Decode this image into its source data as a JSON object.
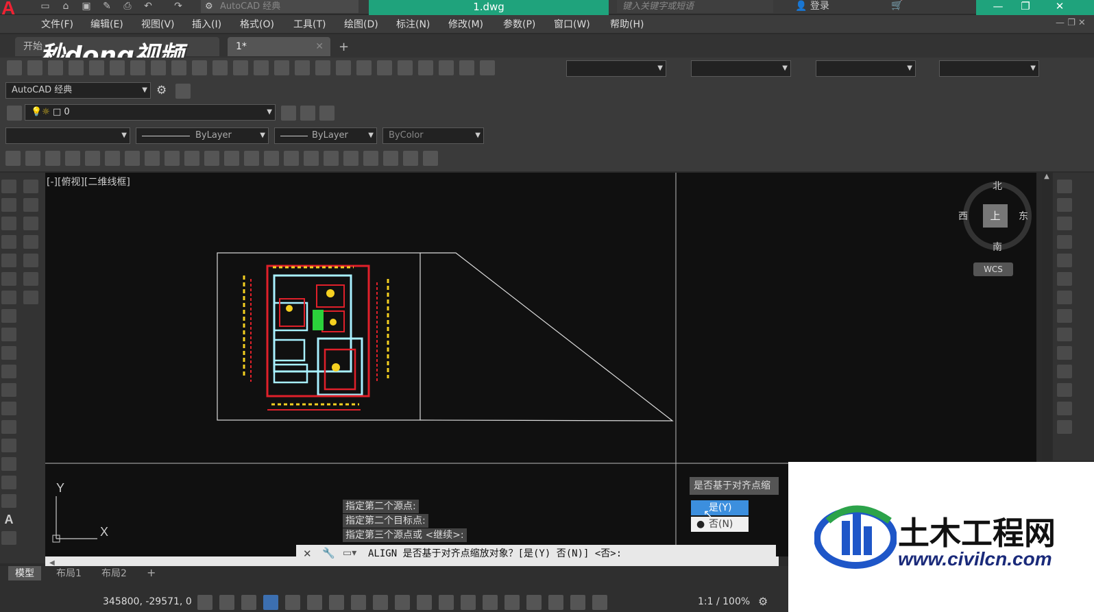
{
  "window": {
    "title": "1.dwg",
    "workspace_combo": "AutoCAD 经典",
    "search_placeholder": "键入关键字或短语",
    "login": "登录"
  },
  "menu": [
    "文件(F)",
    "编辑(E)",
    "视图(V)",
    "插入(I)",
    "格式(O)",
    "工具(T)",
    "绘图(D)",
    "标注(N)",
    "修改(M)",
    "参数(P)",
    "窗口(W)",
    "帮助(H)"
  ],
  "tabs": {
    "start": "开始",
    "doc": "1*",
    "watermark": "秒dong视频"
  },
  "toolbar": {
    "workspace": "AutoCAD 经典",
    "layer": "0",
    "linetype": "ByLayer",
    "lineweight": "ByLayer",
    "plotstyle": "ByColor"
  },
  "canvas": {
    "view_label": "[-][俯视][二维线框]",
    "compass": {
      "north": "北",
      "south": "南",
      "east": "东",
      "west": "西",
      "top": "上"
    },
    "wcs": "WCS",
    "ucs_x": "X",
    "ucs_y": "Y"
  },
  "command": {
    "history": [
      "指定第二个源点:",
      "指定第二个目标点:",
      "指定第三个源点或 <继续>:"
    ],
    "prompt": "ALIGN 是否基于对齐点缩放对象？[是(Y) 否(N)] <否>:"
  },
  "popup": {
    "title": "是否基于对齐点缩",
    "yes": "是(Y)",
    "no": "否(N)"
  },
  "layout_tabs": [
    "模型",
    "布局1",
    "布局2"
  ],
  "status": {
    "coords": "345800, -29571, 0",
    "scale": "1:1 / 100%"
  },
  "logo": {
    "name": "土木工程网",
    "url": "www.civilcn.com"
  },
  "colors": {
    "accent": "#1fa37c",
    "drawing_red": "#e0202a",
    "drawing_yellow": "#f5d020",
    "drawing_cyan": "#a8f0ff"
  }
}
